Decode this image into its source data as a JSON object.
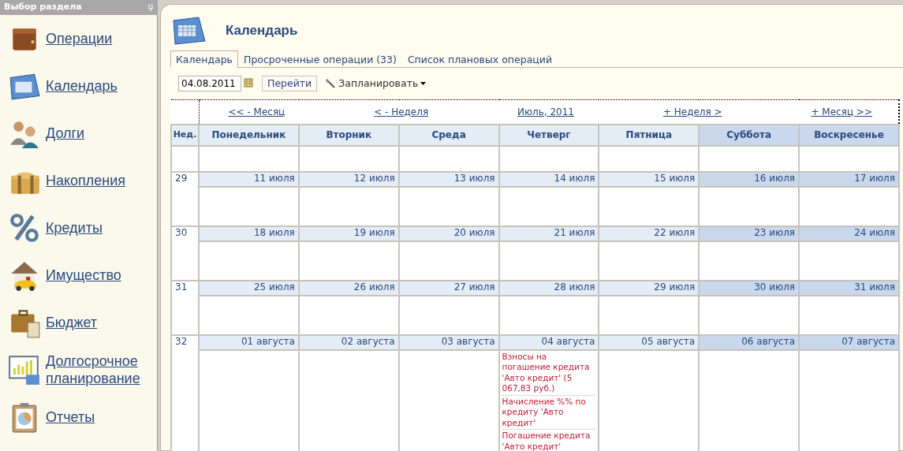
{
  "sidebar": {
    "title": "Выбор раздела",
    "items": [
      {
        "label": "Операции"
      },
      {
        "label": "Календарь"
      },
      {
        "label": "Долги"
      },
      {
        "label": "Накопления"
      },
      {
        "label": "Кредиты"
      },
      {
        "label": "Имущество"
      },
      {
        "label": "Бюджет"
      },
      {
        "label": "Долгосрочное планирование"
      },
      {
        "label": "Отчеты"
      }
    ]
  },
  "title": "Календарь",
  "tabs": [
    {
      "label": "Календарь",
      "selected": true
    },
    {
      "label": "Просроченные операции (33)",
      "selected": false
    },
    {
      "label": "Список плановых операций",
      "selected": false
    }
  ],
  "date_field": {
    "value": "04.08.2011"
  },
  "go_button": "Перейти",
  "schedule_button": "Запланировать",
  "nav": [
    "<< - Месяц",
    "< - Неделя",
    "Июль, 2011",
    "+ Неделя >",
    "+ Месяц >>"
  ],
  "calendar": {
    "week_header": "Нед.",
    "columns": [
      {
        "label": "Понедельник",
        "weekend": false
      },
      {
        "label": "Вторник",
        "weekend": false
      },
      {
        "label": "Среда",
        "weekend": false
      },
      {
        "label": "Четверг",
        "weekend": false
      },
      {
        "label": "Пятница",
        "weekend": false
      },
      {
        "label": "Суббота",
        "weekend": true
      },
      {
        "label": "Воскресенье",
        "weekend": true
      }
    ],
    "weeks": [
      {
        "kind": "blank"
      },
      {
        "kind": "week",
        "number": "29",
        "days": [
          {
            "date": "11 июля"
          },
          {
            "date": "12 июля"
          },
          {
            "date": "13 июля"
          },
          {
            "date": "14 июля"
          },
          {
            "date": "15 июля"
          },
          {
            "date": "16 июля"
          },
          {
            "date": "17 июля"
          }
        ]
      },
      {
        "kind": "week",
        "number": "30",
        "days": [
          {
            "date": "18 июля"
          },
          {
            "date": "19 июля"
          },
          {
            "date": "20 июля"
          },
          {
            "date": "21 июля"
          },
          {
            "date": "22 июля"
          },
          {
            "date": "23 июля"
          },
          {
            "date": "24 июля"
          }
        ]
      },
      {
        "kind": "week",
        "number": "31",
        "days": [
          {
            "date": "25 июля"
          },
          {
            "date": "26 июля"
          },
          {
            "date": "27 июля"
          },
          {
            "date": "28 июля"
          },
          {
            "date": "29 июля"
          },
          {
            "date": "30 июля"
          },
          {
            "date": "31 июля"
          }
        ]
      },
      {
        "kind": "week",
        "number": "32",
        "days": [
          {
            "date": "01 августа"
          },
          {
            "date": "02 августа"
          },
          {
            "date": "03 августа"
          },
          {
            "date": "04 августа",
            "events": [
              "Взносы на погашение кредита 'Авто кредит' (5 067,83 руб.)",
              "Начисление %% по кредиту 'Авто кредит'",
              "Погашение кредита 'Авто кредит'"
            ]
          },
          {
            "date": "05 августа"
          },
          {
            "date": "06 августа"
          },
          {
            "date": "07 августа"
          }
        ]
      }
    ]
  }
}
